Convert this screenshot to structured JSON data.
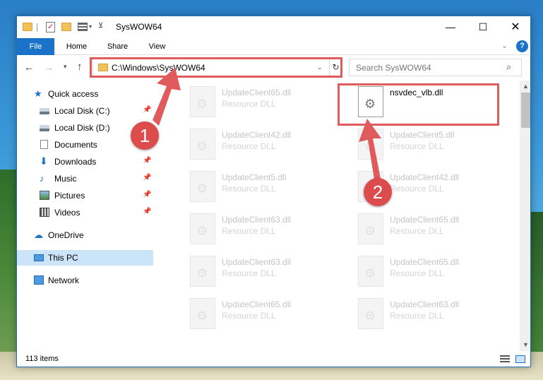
{
  "window": {
    "title": "SysWOW64",
    "min_label": "—",
    "max_label": "☐",
    "close_label": "✕"
  },
  "ribbon": {
    "tabs": [
      "File",
      "Home",
      "Share",
      "View"
    ],
    "expand_label": "⌄",
    "help_label": "?"
  },
  "navbar": {
    "address": "C:\\Windows\\SysWOW64",
    "search_placeholder": "Search SysWOW64"
  },
  "nav_pane": {
    "items": [
      {
        "label": "Quick access",
        "icon": "star-icon",
        "pinned": false
      },
      {
        "label": "Local Disk (C:)",
        "icon": "disk-icon",
        "pinned": true
      },
      {
        "label": "Local Disk (D:)",
        "icon": "disk-icon",
        "pinned": false
      },
      {
        "label": "Documents",
        "icon": "documents-icon",
        "pinned": true
      },
      {
        "label": "Downloads",
        "icon": "download-icon",
        "pinned": true
      },
      {
        "label": "Music",
        "icon": "music-icon",
        "pinned": true
      },
      {
        "label": "Pictures",
        "icon": "pictures-icon",
        "pinned": true
      },
      {
        "label": "Videos",
        "icon": "videos-icon",
        "pinned": true
      },
      {
        "label": "OneDrive",
        "icon": "cloud-icon",
        "pinned": false
      },
      {
        "label": "This PC",
        "icon": "pc-icon",
        "pinned": false,
        "selected": true
      },
      {
        "label": "Network",
        "icon": "network-icon",
        "pinned": false
      }
    ]
  },
  "files": [
    {
      "name": "UpdateClient65.dll",
      "type": "Resource DLL"
    },
    {
      "name": "nsvdec_vlb.dll",
      "type": "",
      "active": true
    },
    {
      "name": "UpdateClient42.dll",
      "type": "Resource DLL"
    },
    {
      "name": "UpdateClient5.dll",
      "type": "Resource DLL"
    },
    {
      "name": "UpdateClient5.dll",
      "type": "Resource DLL"
    },
    {
      "name": "UpdateClient42.dll",
      "type": "Resource DLL"
    },
    {
      "name": "UpdateClient63.dll",
      "type": "Resource DLL"
    },
    {
      "name": "UpdateClient65.dll",
      "type": "Resource DLL"
    },
    {
      "name": "UpdateClient63.dll",
      "type": "Resource DLL"
    },
    {
      "name": "UpdateClient65.dll",
      "type": "Resource DLL"
    },
    {
      "name": "UpdateClient65.dll",
      "type": "Resource DLL"
    },
    {
      "name": "UpdateClient63.dll",
      "type": "Resource DLL"
    }
  ],
  "status": {
    "item_count": "113 items"
  },
  "annotations": {
    "step1": "1",
    "step2": "2",
    "color": "#e05b5b"
  }
}
